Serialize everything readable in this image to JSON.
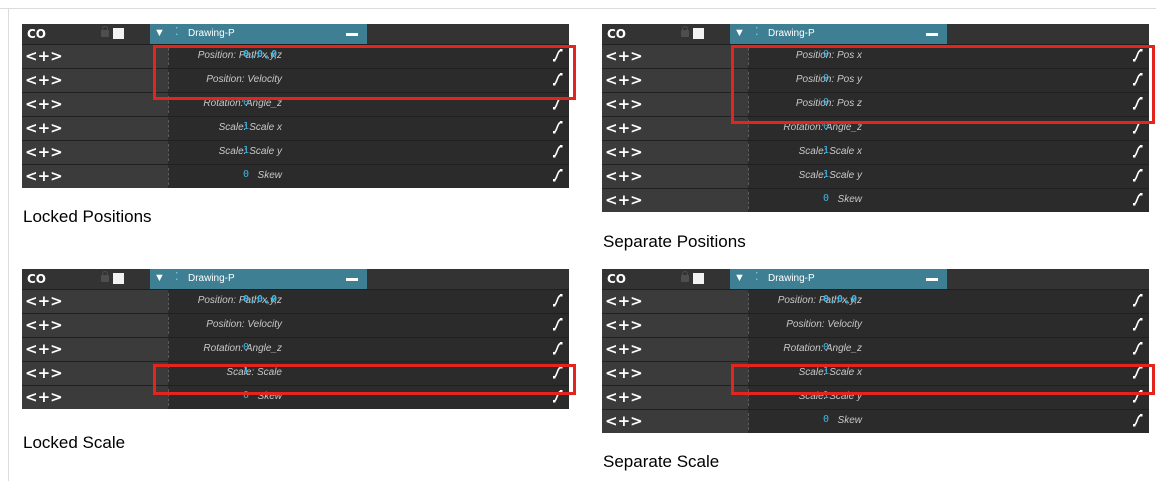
{
  "panels": {
    "locked_positions": {
      "caption": "Locked Positions",
      "header": {
        "logo": "CO",
        "layer_name": "Drawing-P"
      },
      "rows": [
        {
          "nav": "<+>",
          "label": "Position: Path x,y,z",
          "value": "0,0,0"
        },
        {
          "nav": "<+>",
          "label": "Position: Velocity",
          "value": ""
        },
        {
          "nav": "<+>",
          "label": "Rotation: Angle_z",
          "value": "0"
        },
        {
          "nav": "<+>",
          "label": "Scale: Scale x",
          "value": "1"
        },
        {
          "nav": "<+>",
          "label": "Scale: Scale y",
          "value": "1"
        },
        {
          "nav": "<+>",
          "label": "Skew",
          "value": "0"
        }
      ]
    },
    "separate_positions": {
      "caption": "Separate Positions",
      "header": {
        "logo": "CO",
        "layer_name": "Drawing-P"
      },
      "rows": [
        {
          "nav": "<+>",
          "label": "Position: Pos x",
          "value": "0"
        },
        {
          "nav": "<+>",
          "label": "Position: Pos y",
          "value": "0"
        },
        {
          "nav": "<+>",
          "label": "Position: Pos z",
          "value": "0"
        },
        {
          "nav": "<+>",
          "label": "Rotation: Angle_z",
          "value": "0"
        },
        {
          "nav": "<+>",
          "label": "Scale: Scale x",
          "value": "1"
        },
        {
          "nav": "<+>",
          "label": "Scale: Scale y",
          "value": "1"
        },
        {
          "nav": "<+>",
          "label": "Skew",
          "value": "0"
        }
      ]
    },
    "locked_scale": {
      "caption": "Locked Scale",
      "header": {
        "logo": "CO",
        "layer_name": "Drawing-P"
      },
      "rows": [
        {
          "nav": "<+>",
          "label": "Position: Path x,y,z",
          "value": "0,0,0"
        },
        {
          "nav": "<+>",
          "label": "Position: Velocity",
          "value": ""
        },
        {
          "nav": "<+>",
          "label": "Rotation: Angle_z",
          "value": "0"
        },
        {
          "nav": "<+>",
          "label": "Scale: Scale",
          "value": "1"
        },
        {
          "nav": "<+>",
          "label": "Skew",
          "value": "0"
        }
      ]
    },
    "separate_scale": {
      "caption": "Separate Scale",
      "header": {
        "logo": "CO",
        "layer_name": "Drawing-P"
      },
      "rows": [
        {
          "nav": "<+>",
          "label": "Position: Path x,y,z",
          "value": "0,0,0"
        },
        {
          "nav": "<+>",
          "label": "Position: Velocity",
          "value": ""
        },
        {
          "nav": "<+>",
          "label": "Rotation: Angle_z",
          "value": "0"
        },
        {
          "nav": "<+>",
          "label": "Scale: Scale x",
          "value": "1"
        },
        {
          "nav": "<+>",
          "label": "Scale: Scale y",
          "value": "1"
        },
        {
          "nav": "<+>",
          "label": "Skew",
          "value": "0"
        }
      ]
    }
  },
  "colors": {
    "highlight": "#e2261d",
    "layer_header": "#3f7f93",
    "value_text": "#3fb6e6",
    "panel_bg": "#2b2b2b",
    "nav_bg": "#3b3b3b"
  },
  "icons": {
    "function_curve": "function-curve-icon",
    "lock": "lock-icon",
    "expand": "expand-triangle-icon",
    "layer_type": "drawing-layer-icon",
    "collapse": "minus-icon"
  }
}
